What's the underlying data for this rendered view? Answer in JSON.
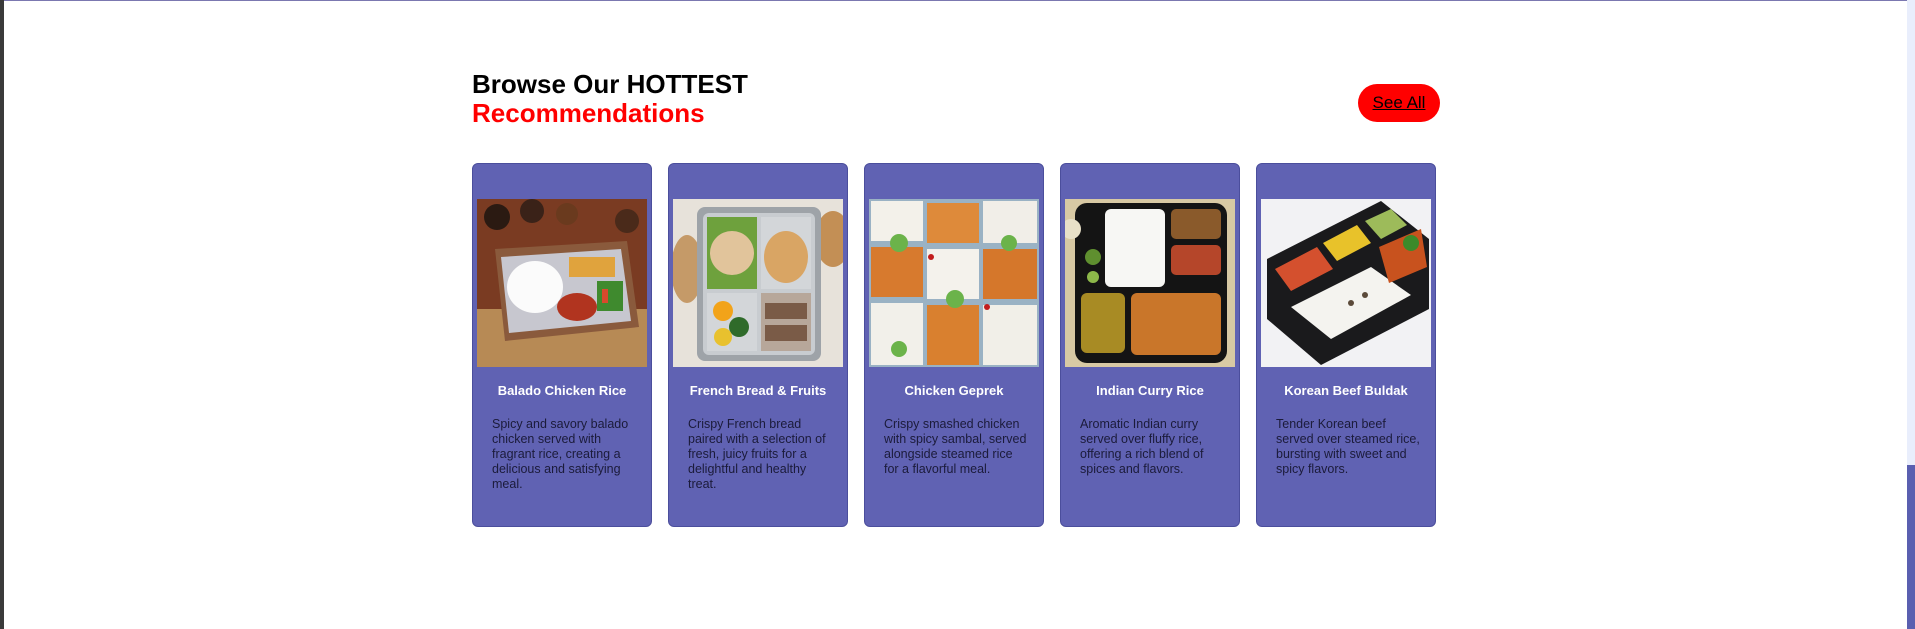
{
  "header": {
    "title_line1": "Browse Our HOTTEST",
    "title_line2": "Recommendations",
    "see_all_label": "See All"
  },
  "colors": {
    "accent_red": "#ff0000",
    "card_bg": "#6062b3"
  },
  "cards": [
    {
      "title": "Balado Chicken Rice",
      "description": "Spicy and savory balado chicken served with fragrant rice, creating a delicious and satisfying meal.",
      "image": "bento-box-rice-chicken-photo"
    },
    {
      "title": "French Bread & Fruits",
      "description": "Crispy French bread paired with a selection of fresh, juicy fruits for a delightful and healthy treat.",
      "image": "lunchbox-bread-fruits-photo"
    },
    {
      "title": "Chicken Geprek",
      "description": "Crispy smashed chicken with spicy sambal, served alongside steamed rice for a flavorful meal.",
      "image": "meal-trays-chicken-geprek-photo"
    },
    {
      "title": "Indian Curry Rice",
      "description": "Aromatic Indian curry served over fluffy rice, offering a rich blend of spices and flavors.",
      "image": "black-tray-curry-rice-photo"
    },
    {
      "title": "Korean Beef Buldak",
      "description": "Tender Korean beef served over steamed rice, bursting with sweet and spicy flavors.",
      "image": "black-tray-korean-beef-photo"
    }
  ]
}
